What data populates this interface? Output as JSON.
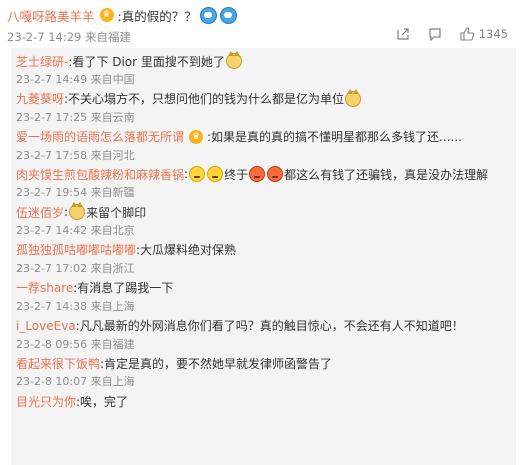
{
  "main_comment": {
    "username": "八嘎呀路美羊羊",
    "text": ":真的假的？？",
    "meta": "23-2-7 14:29 来自福建",
    "like_count": "1345"
  },
  "replies": [
    {
      "name": "芝士绿研-",
      "text": ":看了下 Dior 里面搜不到她了",
      "meta": "23-2-7 14:49 来自中国"
    },
    {
      "name": "九菱葵呀",
      "text": ":不关心塌方不，只想问他们的钱为什么都是亿为单位",
      "meta": "23-2-7 17:25 来自云南"
    },
    {
      "name": "爱一场雨的语雨怎么落都无所谓",
      "text": ":如果是真的真的搞不懂明星都那么多钱了还......",
      "meta": "23-2-7 17:58 来自河北"
    },
    {
      "name": "肉夹馍生煎包酸辣粉和麻辣香锅",
      "text_a": ":",
      "text_b": "终于",
      "text_c": "都这么有钱了还骗钱，真是没办法理解",
      "meta": "23-2-7 19:54 来自新疆"
    },
    {
      "name": "伍迷佰岁",
      "text": ":",
      "text_after": "来留个脚印",
      "meta": "23-2-7 14:42 来自北京"
    },
    {
      "name": "孤独独孤咕嘟嘟咕嘟嘟",
      "text": ":大瓜爆料绝对保熟",
      "meta": "23-2-7 17:02 来自浙江"
    },
    {
      "name": "一荐share",
      "text": ":有消息了踢我一下",
      "meta": "23-2-7 14:38 来自上海"
    },
    {
      "name": "i_LoveEva",
      "text": ":凡凡最新的外网消息你们看了吗？真的触目惊心，不会还有人不知道吧！",
      "meta": "23-2-8 09:56 来自福建"
    },
    {
      "name": "看起来很下饭鸭",
      "text": ":肯定是真的，要不然她早就发律师函警告了",
      "meta": "23-2-8 10:07 来自上海"
    },
    {
      "name": "目光只为你",
      "text": ":唉，完了",
      "meta": ""
    }
  ],
  "icons": {
    "crown": "crown-icon",
    "share": "share-icon",
    "comment": "comment-icon",
    "like": "like-icon",
    "emoji_doraemon": "doraemon-emoji-icon",
    "emoji_cat": "cat-emoji-icon",
    "emoji_smile": "smile-emoji-icon",
    "emoji_angry": "angry-emoji-icon"
  },
  "colors": {
    "username": "#eb7350",
    "meta": "#8e8e8e",
    "reply_bg": "#f4f4f4",
    "crown": "#ffb21a"
  }
}
